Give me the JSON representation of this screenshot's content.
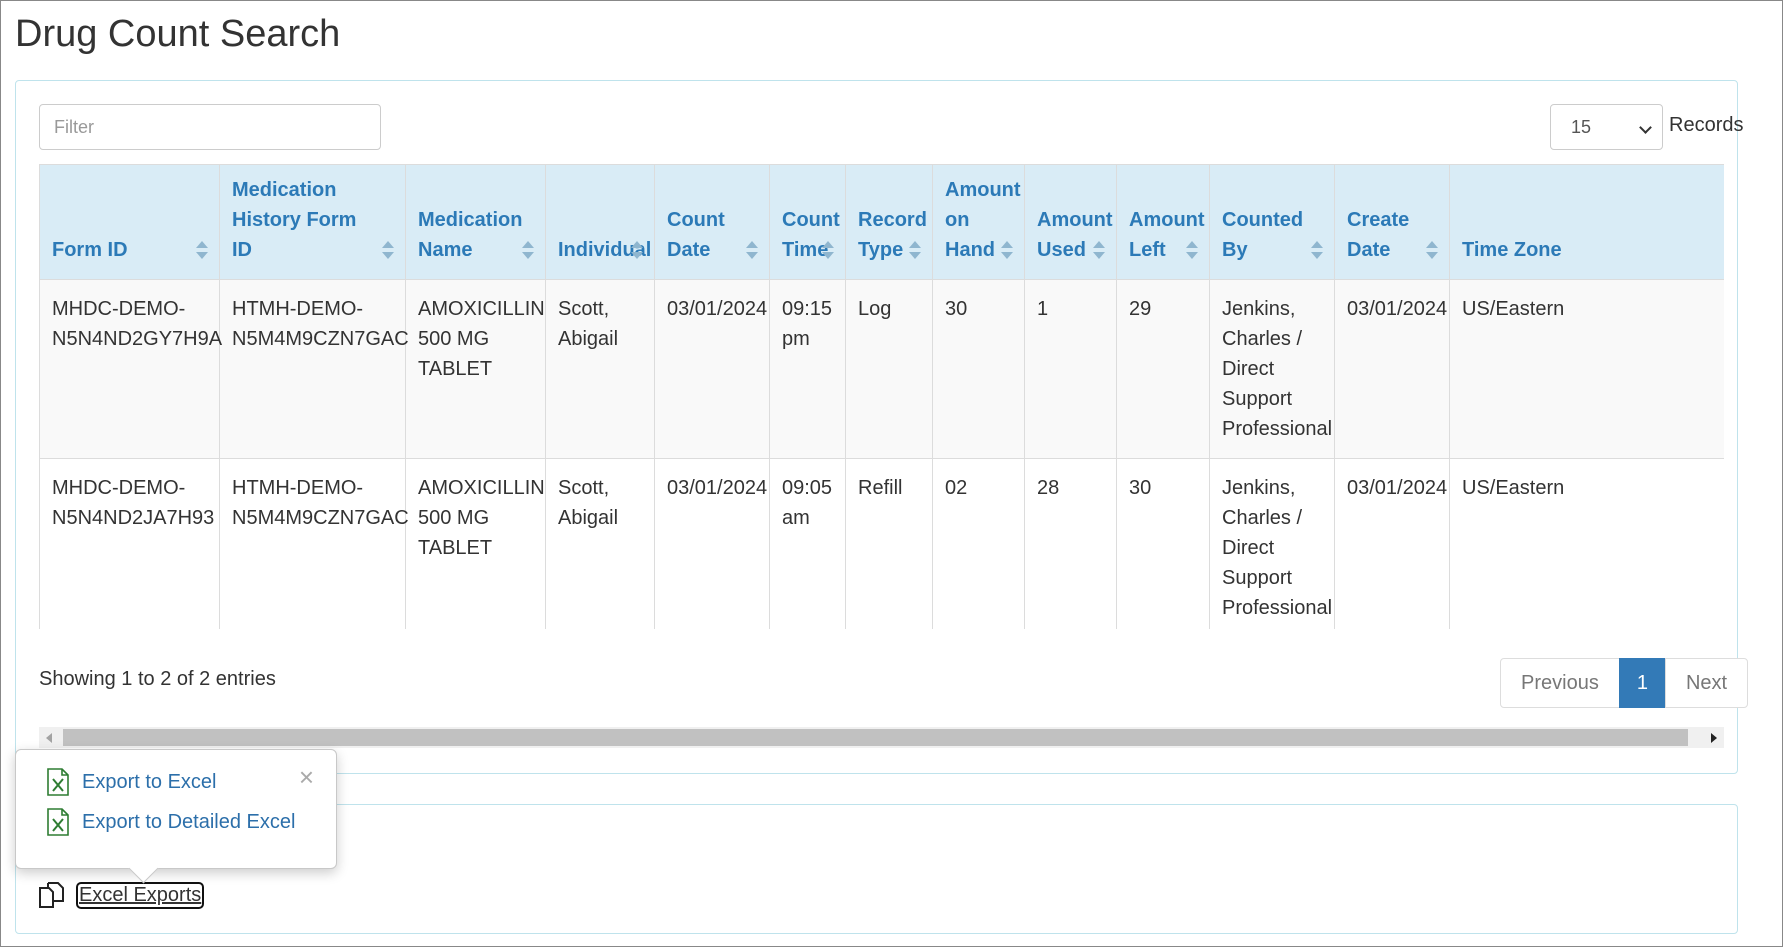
{
  "page_title": "Drug Count Search",
  "filter": {
    "placeholder": "Filter",
    "value": ""
  },
  "records": {
    "selected": "15",
    "label": "Records"
  },
  "table": {
    "columns": [
      "Form ID",
      "Medication History Form ID",
      "Medication Name",
      "Individual",
      "Count Date",
      "Count Time",
      "Record Type",
      "Amount on Hand",
      "Amount Used",
      "Amount Left",
      "Counted By",
      "Create Date",
      "Time Zone"
    ],
    "rows": [
      [
        "MHDC-DEMO-N5N4ND2GY7H9A",
        "HTMH-DEMO-N5M4M9CZN7GAC",
        "AMOXICILLIN 500 MG TABLET",
        "Scott, Abigail",
        "03/01/2024",
        "09:15 pm",
        "Log",
        "30",
        "1",
        "29",
        "Jenkins, Charles / Direct Support Professional",
        "03/01/2024",
        "US/Eastern"
      ],
      [
        "MHDC-DEMO-N5N4ND2JA7H93",
        "HTMH-DEMO-N5M4M9CZN7GAC",
        "AMOXICILLIN 500 MG TABLET",
        "Scott, Abigail",
        "03/01/2024",
        "09:05 am",
        "Refill",
        "02",
        "28",
        "30",
        "Jenkins, Charles / Direct Support Professional",
        "03/01/2024",
        "US/Eastern"
      ]
    ]
  },
  "footer": {
    "showing": "Showing 1 to 2 of 2 entries"
  },
  "pagination": {
    "previous": "Previous",
    "current": "1",
    "next": "Next"
  },
  "popover": {
    "items": [
      "Export to Excel",
      "Export to Detailed Excel"
    ],
    "close": "×"
  },
  "excel_exports_label": "Excel Exports",
  "icons": {
    "excel": "excel-file-icon",
    "copy": "copy-icon",
    "sort": "sort-icon",
    "close": "close-icon"
  },
  "colors": {
    "header_bg": "#d9ecf6",
    "header_text": "#2c7ab7",
    "active_page": "#337ab7",
    "excel_green": "#2e7d32",
    "link_blue": "#2c6faa"
  }
}
